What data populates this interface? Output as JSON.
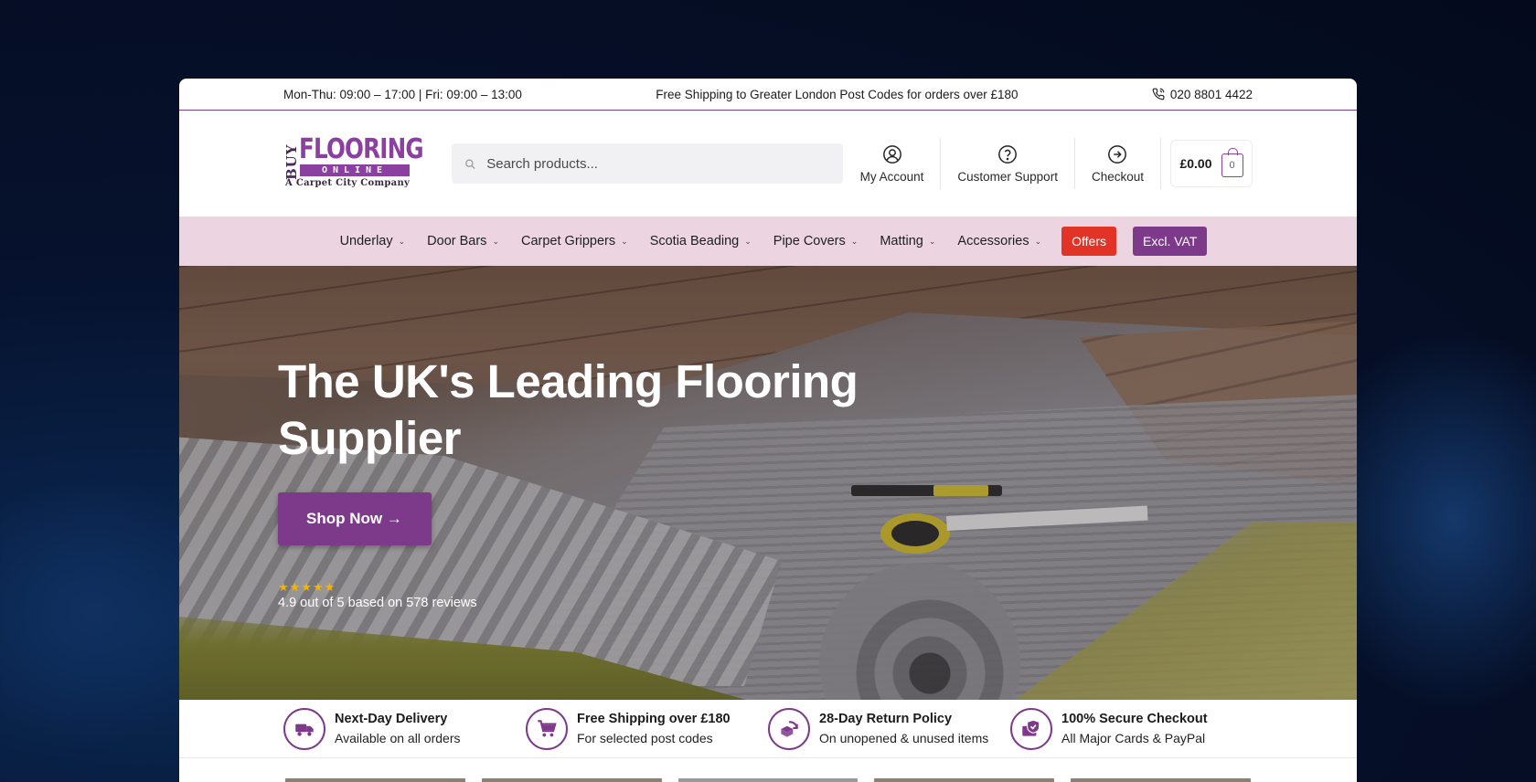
{
  "topbar": {
    "hours": "Mon-Thu: 09:00 – 17:00 | Fri: 09:00 – 13:00",
    "shipping_notice": "Free Shipping to Greater London Post Codes for orders over £180",
    "phone": "020 8801 4422"
  },
  "logo": {
    "buy": "BUY",
    "flooring": "FLOORING",
    "online": "ONLINE",
    "company": "A Carpet City Company"
  },
  "search": {
    "placeholder": "Search products..."
  },
  "header_actions": {
    "account": "My Account",
    "support": "Customer Support",
    "checkout": "Checkout"
  },
  "cart": {
    "total": "£0.00",
    "count": "0"
  },
  "nav": {
    "items": [
      "Underlay",
      "Door Bars",
      "Carpet Grippers",
      "Scotia Beading",
      "Pipe Covers",
      "Matting",
      "Accessories"
    ],
    "offers": "Offers",
    "vat": "Excl. VAT"
  },
  "hero": {
    "title": "The UK's Leading Flooring Supplier",
    "cta": "Shop Now →",
    "stars": "★★★★★",
    "rating": "4.9 out of 5 based on 578 reviews"
  },
  "features": [
    {
      "title": "Next-Day Delivery",
      "subtitle": "Available on all orders",
      "icon": "delivery-truck-icon"
    },
    {
      "title": "Free Shipping over £180",
      "subtitle": "For selected post codes",
      "icon": "shopping-cart-icon"
    },
    {
      "title": "28-Day Return Policy",
      "subtitle": "On unopened & unused items",
      "icon": "return-box-icon"
    },
    {
      "title": "100% Secure Checkout",
      "subtitle": "All Major Cards & PayPal",
      "icon": "secure-card-icon"
    }
  ],
  "colors": {
    "brand_purple": "#7d3a8b",
    "nav_bg": "#ecd5e0",
    "offers_red": "#e23426",
    "star_gold": "#f5b400"
  }
}
